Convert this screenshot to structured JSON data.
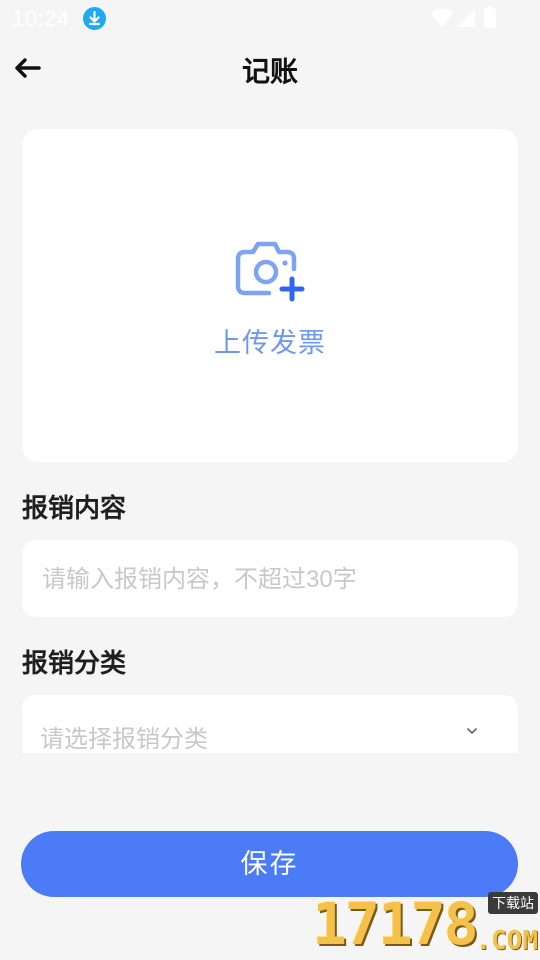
{
  "status_bar": {
    "time": "10:24"
  },
  "header": {
    "title": "记账"
  },
  "upload": {
    "label": "上传发票"
  },
  "content_section": {
    "label": "报销内容",
    "placeholder": "请输入报销内容，不超过30字",
    "value": ""
  },
  "category_section": {
    "label": "报销分类",
    "placeholder": "请选择报销分类"
  },
  "save_button": {
    "label": "保存"
  },
  "watermark": {
    "number": "17178",
    "domain": ".COM",
    "badge": "下载站"
  },
  "colors": {
    "accent": "#4b7bf7",
    "upload_text": "#6e97f2",
    "background": "#f5f5f5"
  }
}
